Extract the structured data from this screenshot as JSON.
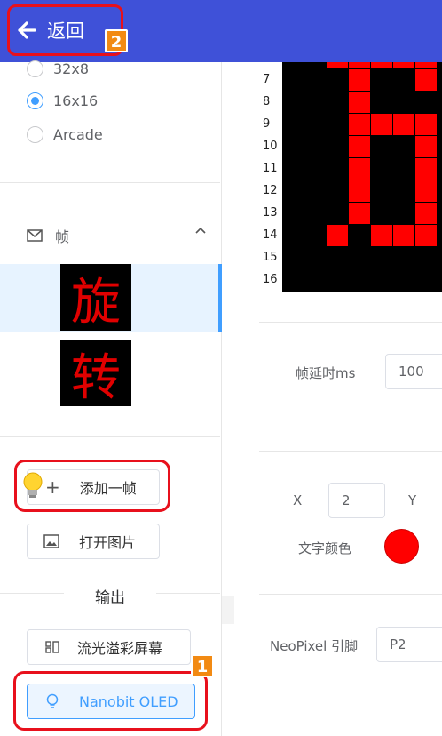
{
  "header": {
    "back_label": "返回",
    "badge": "2"
  },
  "size_options": [
    {
      "label": "32x8",
      "checked": false
    },
    {
      "label": "16x16",
      "checked": true
    },
    {
      "label": "Arcade",
      "checked": false
    }
  ],
  "frames": {
    "title": "帧",
    "items": [
      "旋",
      "转"
    ]
  },
  "buttons": {
    "add_frame": "添加一帧",
    "open_image": "打开图片"
  },
  "output": {
    "title": "输出",
    "neopixel": "流光溢彩屏幕",
    "oled": "Nanobit OLED",
    "badge": "1"
  },
  "matrix": {
    "row_numbers": [
      "7",
      "8",
      "9",
      "10",
      "11",
      "12",
      "13",
      "14",
      "15",
      "16"
    ]
  },
  "settings": {
    "delay_label": "帧延时ms",
    "delay_value": "100",
    "x_label": "X",
    "x_value": "2",
    "y_label": "Y",
    "text_color_label": "文字颜色",
    "text_color": "#ff0000",
    "pin_label": "NeoPixel 引脚",
    "pin_value": "P2"
  },
  "colors": {
    "header_bg": "#3f51d8",
    "accent": "#409eff",
    "highlight": "#e8101c",
    "badge": "#f28a13"
  }
}
